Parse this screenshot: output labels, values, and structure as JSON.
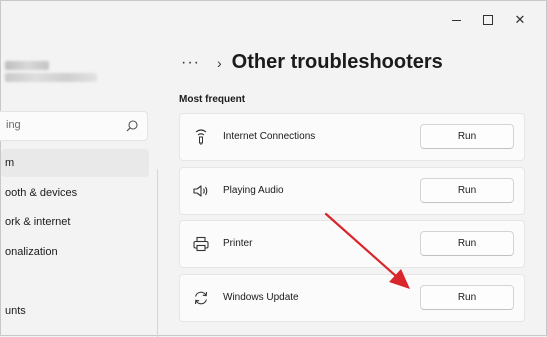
{
  "window": {
    "controls": {
      "minimize": "minimize",
      "maximize": "maximize",
      "close": "✕"
    }
  },
  "sidebar": {
    "search_placeholder": "ing",
    "items": [
      {
        "label": "m"
      },
      {
        "label": "ooth & devices"
      },
      {
        "label": "ork & internet"
      },
      {
        "label": "onalization"
      },
      {
        "label": "unts"
      }
    ]
  },
  "header": {
    "more": "···",
    "separator": "›",
    "title": "Other troubleshooters"
  },
  "main": {
    "section_label": "Most frequent",
    "troubleshooters": [
      {
        "label": "Internet Connections",
        "icon": "wifi-icon",
        "action": "Run"
      },
      {
        "label": "Playing Audio",
        "icon": "speaker-icon",
        "action": "Run"
      },
      {
        "label": "Printer",
        "icon": "printer-icon",
        "action": "Run"
      },
      {
        "label": "Windows Update",
        "icon": "refresh-icon",
        "action": "Run"
      }
    ]
  },
  "annotation": {
    "color": "#d9262c"
  }
}
